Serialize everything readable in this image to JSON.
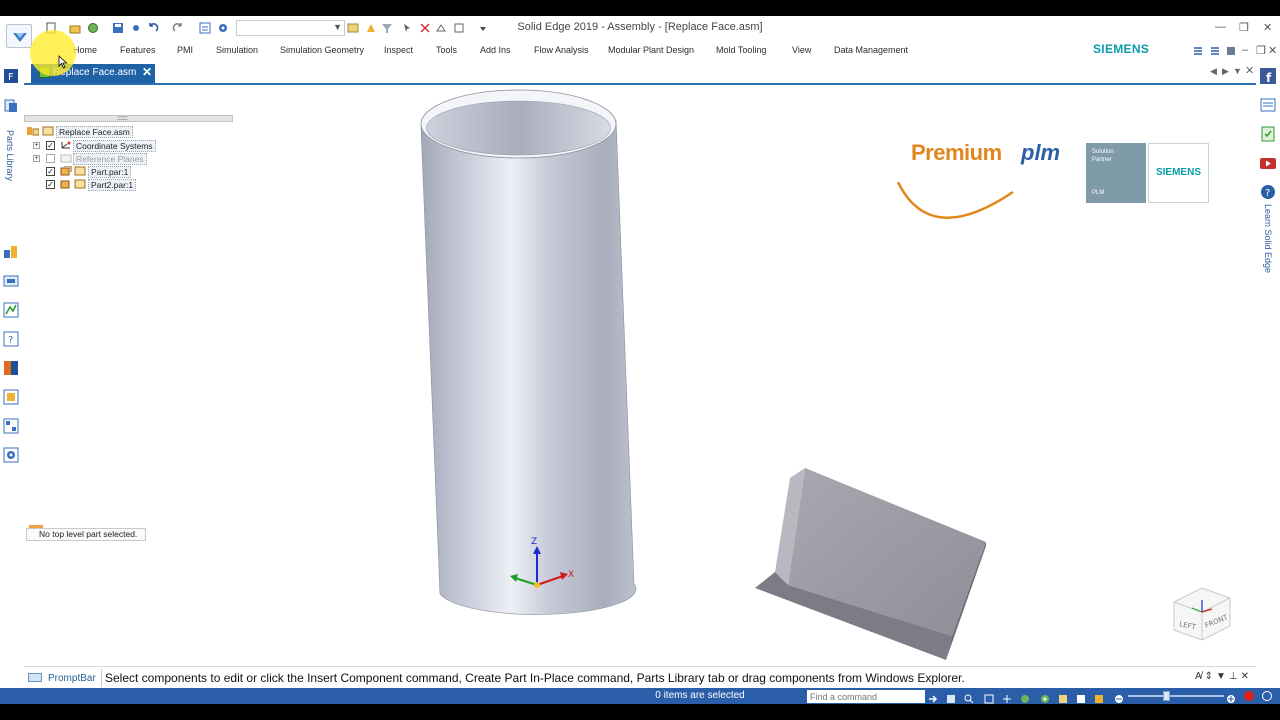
{
  "app": {
    "title": "Solid Edge 2019 - Assembly - [Replace Face.asm]",
    "brand": "SIEMENS",
    "accent_color": "#2b5ea8"
  },
  "ribbon": {
    "tabs": [
      "Home",
      "Features",
      "PMI",
      "Simulation",
      "Simulation Geometry",
      "Inspect",
      "Tools",
      "Add Ins",
      "Flow Analysis",
      "Modular Plant Design",
      "Mold Tooling",
      "View",
      "Data Management"
    ]
  },
  "document_tab": {
    "label": "Replace Face.asm",
    "close": "✕"
  },
  "sidebar": {
    "parts_library_label": "Parts Library",
    "learn_label": "Learn Solid Edge"
  },
  "pathfinder": {
    "items": [
      {
        "label": "Replace Face.asm"
      },
      {
        "label": "Coordinate Systems"
      },
      {
        "label": "Reference Planes"
      },
      {
        "label": "Part.par:1"
      },
      {
        "label": "Part2.par:1"
      }
    ],
    "status": "No top level part selected."
  },
  "logo": {
    "premium_part1": "Premium",
    "premium_part2": "plm",
    "partner_line1": "Solution",
    "partner_line2": "Partner",
    "partner_line3": "PLM",
    "partner_brand": "SIEMENS"
  },
  "viewcube": {
    "left": "LEFT",
    "front": "FRONT"
  },
  "triad": {
    "x": "X",
    "z": "Z"
  },
  "promptbar": {
    "label": "PromptBar",
    "message": "Select components to edit or click the Insert Component command, Create Part In-Place command, Parts Library tab or drag components from Windows Explorer."
  },
  "statusbar": {
    "selection_count": "0 items are selected",
    "find_placeholder": "Find a command"
  }
}
